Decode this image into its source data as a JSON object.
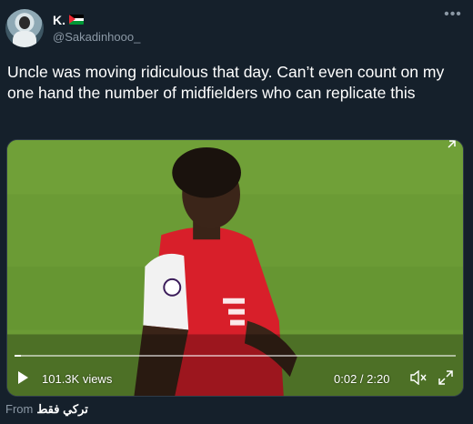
{
  "author": {
    "display_name": "K.",
    "flag_icon": "palestine-flag-icon",
    "handle": "@Sakadinhooo_"
  },
  "tweet": {
    "text": "Uncle was moving ridiculous that day. Can’t even count on my one hand the number of midfielders who can replicate this"
  },
  "video": {
    "views": "101.3K views",
    "time": "0:02 / 2:20",
    "progress_fraction": 0.015
  },
  "footer": {
    "from_label": "From",
    "source": "تركي فقط"
  },
  "icons": {
    "more": "more-options-icon",
    "play": "play-icon",
    "mute": "speaker-muted-icon",
    "expand": "expand-icon"
  },
  "colors": {
    "background": "#15202b",
    "muted_text": "#8b98a5",
    "pitch_green": "#6a9a33",
    "kit_red": "#e0202b"
  }
}
